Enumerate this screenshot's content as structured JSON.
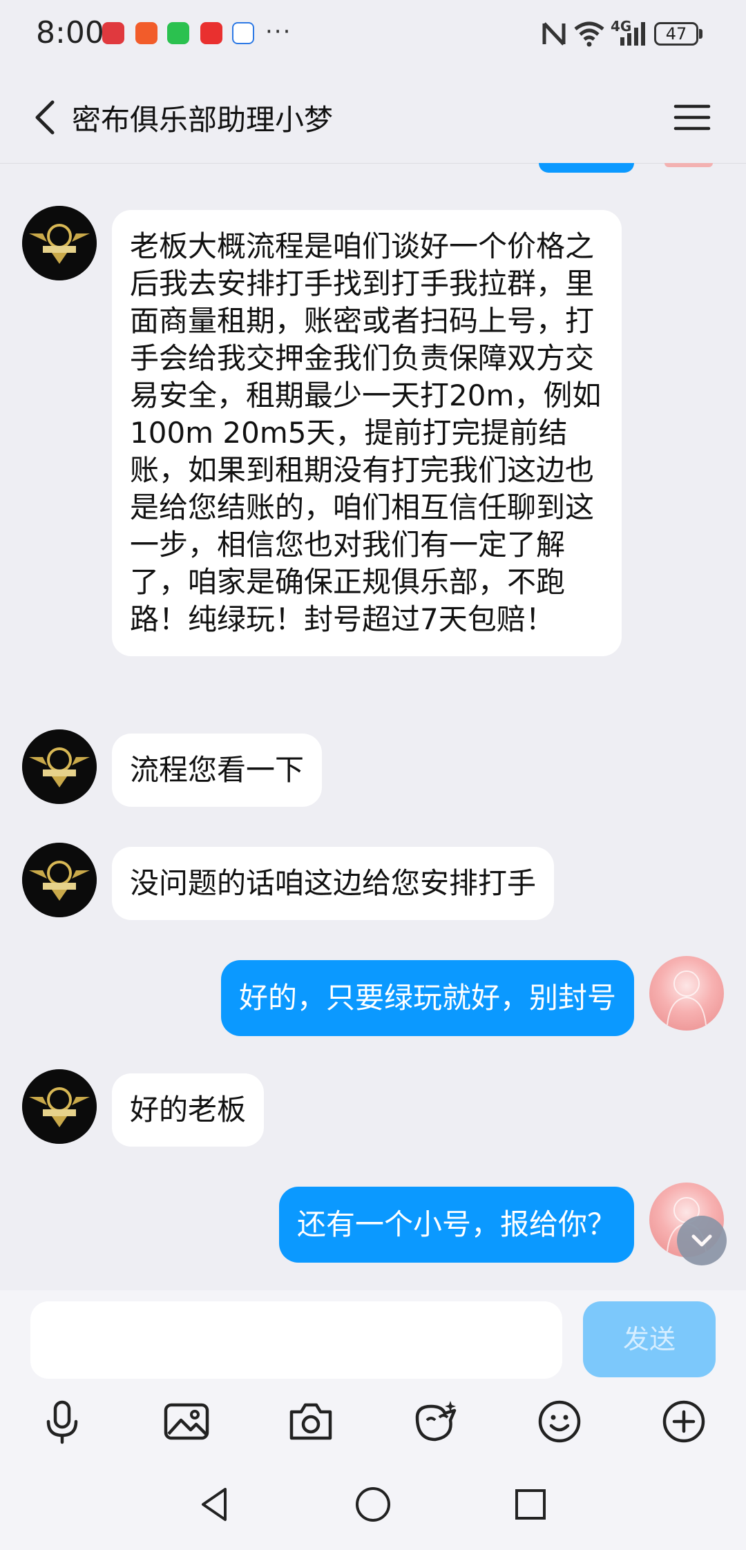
{
  "status_bar": {
    "time": "8:00",
    "more": "···",
    "network": "4G",
    "battery": "47"
  },
  "header": {
    "title": "密布俱乐部助理小梦"
  },
  "messages": [
    {
      "from": "bot",
      "text": "老板大概流程是咱们谈好一个价格之后我去安排打手找到打手我拉群，里面商量租期，账密或者扫码上号，打手会给我交押金我们负责保障双方交易安全，租期最少一天打20m，例如100m 20m5天，提前打完提前结账，如果到租期没有打完我们这边也是给您结账的，咱们相互信任聊到这一步，相信您也对我们有一定了解了，咱家是确保正规俱乐部，不跑路！纯绿玩！封号超过7天包赔！"
    },
    {
      "from": "bot",
      "text": "流程您看一下"
    },
    {
      "from": "bot",
      "text": "没问题的话咱这边给您安排打手"
    },
    {
      "from": "me",
      "text": "好的，只要绿玩就好，别封号"
    },
    {
      "from": "bot",
      "text": "好的老板"
    },
    {
      "from": "me",
      "text": "还有一个小号，报给你？"
    }
  ],
  "composer": {
    "placeholder": "",
    "send_label": "发送"
  },
  "toolbar": [
    "mic-icon",
    "image-icon",
    "camera-icon",
    "sticker-icon",
    "emoji-icon",
    "plus-icon"
  ],
  "colors": {
    "background": "#eeeef3",
    "outgoing_bubble": "#0b99ff",
    "incoming_bubble": "#ffffff",
    "send_button": "#7cc8fb"
  }
}
